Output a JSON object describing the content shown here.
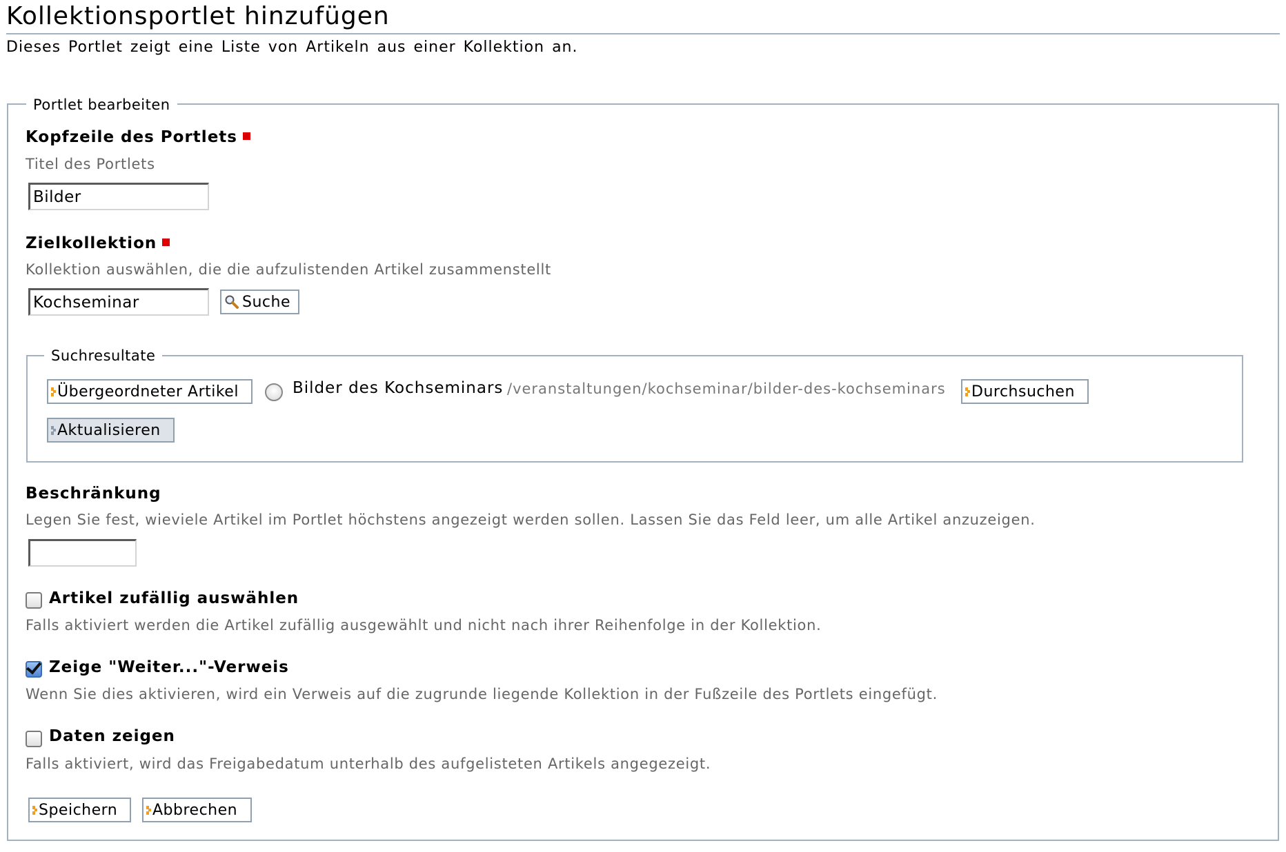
{
  "page": {
    "title": "Kollektionsportlet hinzufügen",
    "description": "Dieses Portlet zeigt eine Liste von Artikeln aus einer Kollektion an."
  },
  "form": {
    "legend": "Portlet bearbeiten",
    "header_field": {
      "label": "Kopfzeile des Portlets",
      "help": "Titel des Portlets",
      "value": "Bilder",
      "required": true
    },
    "target_field": {
      "label": "Zielkollektion",
      "help": "Kollektion auswählen, die die aufzulistenden Artikel zusammenstellt",
      "value": "Kochseminar",
      "search_button": "Suche",
      "required": true
    },
    "search_results": {
      "legend": "Suchresultate",
      "parent_button": "Übergeordneter Artikel",
      "result_title": "Bilder des Kochseminars",
      "result_path": "/veranstaltungen/kochseminar/bilder-des-kochseminars",
      "browse_button": "Durchsuchen",
      "refresh_button": "Aktualisieren"
    },
    "limit_field": {
      "label": "Beschränkung",
      "help": "Legen Sie fest, wieviele Artikel im Portlet höchstens angezeigt werden sollen. Lassen Sie das Feld leer, um alle Artikel anzuzeigen.",
      "value": ""
    },
    "random_field": {
      "label": "Artikel zufällig auswählen",
      "help": "Falls aktiviert werden die Artikel zufällig ausgewählt und nicht nach ihrer Reihenfolge in der Kollektion.",
      "checked": false
    },
    "more_field": {
      "label": "Zeige \"Weiter...\"-Verweis",
      "help": "Wenn Sie dies aktivieren, wird ein Verweis auf die zugrunde liegende Kollektion in der Fußzeile des Portlets eingefügt.",
      "checked": true
    },
    "dates_field": {
      "label": "Daten zeigen",
      "help": "Falls aktiviert, wird das Freigabedatum unterhalb des aufgelisteten Artikels angegezeigt.",
      "checked": false
    },
    "save_button": "Speichern",
    "cancel_button": "Abbrechen"
  },
  "colors": {
    "border": "#a3b2c0",
    "required": "#dd0000",
    "help_text": "#666666",
    "button_icon": "#f0a020"
  }
}
